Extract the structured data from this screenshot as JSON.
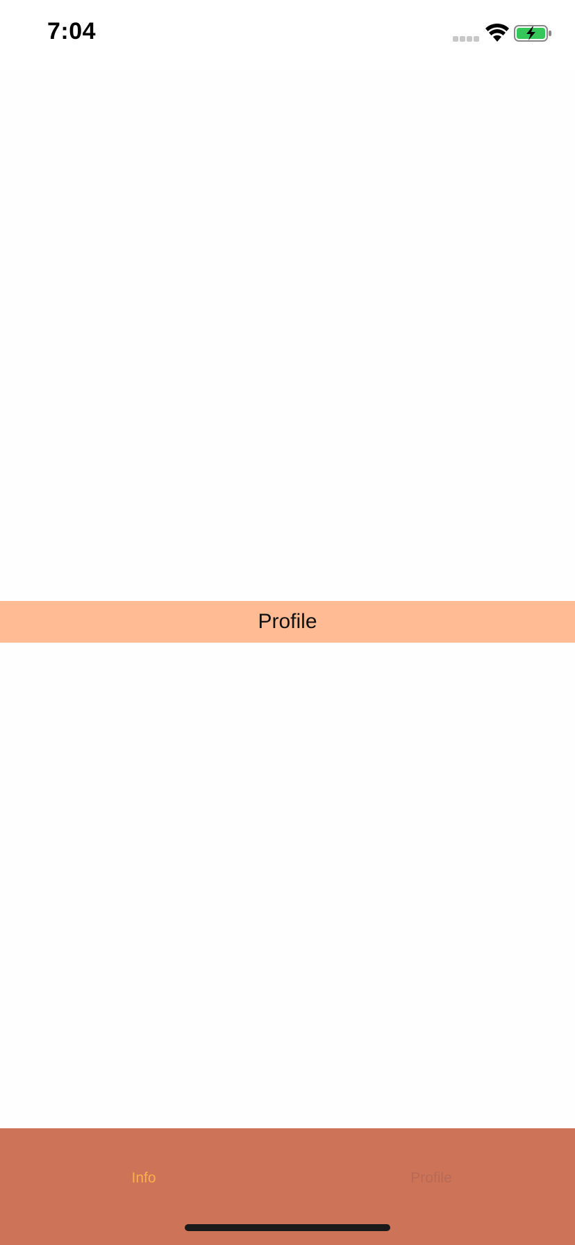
{
  "status_bar": {
    "time": "7:04",
    "battery_color": "#35c759"
  },
  "main": {
    "header_title": "Profile",
    "header_color": "#ffbb93"
  },
  "tab_bar": {
    "background": "#cd7357",
    "tabs": [
      {
        "label": "Info",
        "active": true,
        "color": "#f7b04a"
      },
      {
        "label": "Profile",
        "active": false,
        "color": "#b86a57"
      }
    ]
  }
}
